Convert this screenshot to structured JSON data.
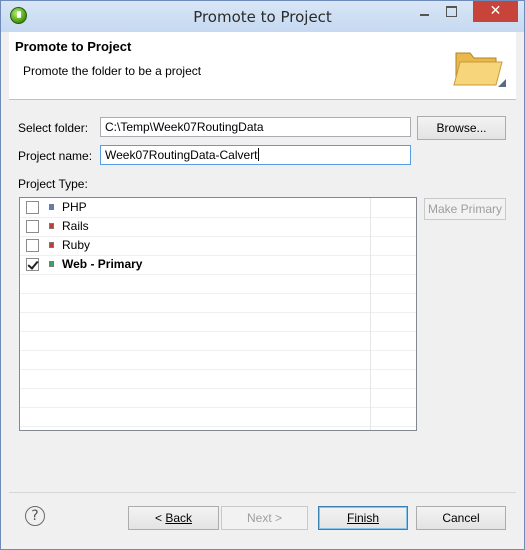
{
  "window": {
    "title": "Promote to Project",
    "close_glyph": "✕"
  },
  "banner": {
    "title": "Promote to Project",
    "description": "Promote the folder to be a project"
  },
  "form": {
    "folder_label": "Select folder:",
    "folder_value": "C:\\Temp\\Week07RoutingData",
    "browse_label": "Browse...",
    "project_name_label": "Project name:",
    "project_name_value": "Week07RoutingData-Calvert"
  },
  "project_type": {
    "label": "Project Type:",
    "make_primary_label": "Make Primary",
    "items": [
      {
        "label": "PHP",
        "checked": false,
        "color": "#5b7fc0"
      },
      {
        "label": "Rails",
        "checked": false,
        "color": "#c23b3b"
      },
      {
        "label": "Ruby",
        "checked": false,
        "color": "#c23b3b"
      },
      {
        "label": "Web - Primary",
        "checked": true,
        "color": "#3b9f6a"
      }
    ]
  },
  "footer": {
    "help_glyph": "?",
    "back_label": "Back",
    "back_prefix": "< ",
    "next_label": "Next >",
    "finish_label": "Finish",
    "cancel_label": "Cancel"
  }
}
